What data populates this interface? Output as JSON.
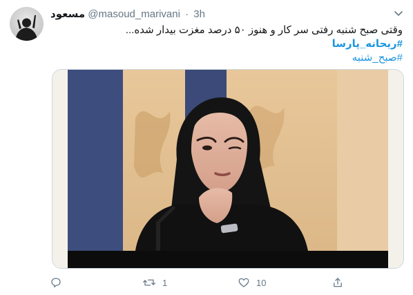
{
  "tweet": {
    "display_name": "مسعود",
    "handle": "@masoud_marivani",
    "separator": "·",
    "time": "3h",
    "text_line": "وقتی صبح شنبه رفتی سر کار و هنوز ۵۰ درصد مغزت بیدار شده...",
    "hashtags": [
      "#ریحانه_پارسا",
      "#صبح_شنبه"
    ]
  },
  "actions": {
    "reply_count": "",
    "retweet_count": "1",
    "like_count": "10",
    "share_count": ""
  },
  "colors": {
    "link": "#1b95e0",
    "muted": "#657786",
    "border": "#ccd6dd"
  },
  "icons": [
    "caret-down-icon",
    "reply-icon",
    "retweet-icon",
    "like-icon",
    "share-icon"
  ]
}
